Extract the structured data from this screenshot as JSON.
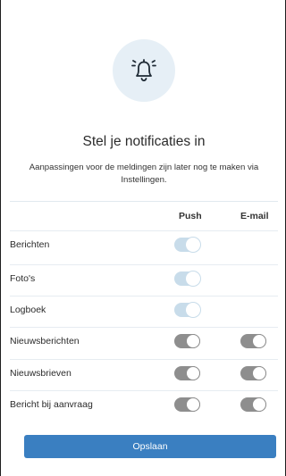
{
  "header": {
    "icon": "bell-icon",
    "title": "Stel je notificaties in",
    "subtitle": "Aanpassingen voor de meldingen zijn later nog te maken via Instellingen."
  },
  "columns": {
    "push": "Push",
    "email": "E-mail"
  },
  "rows": [
    {
      "label": "Berichten",
      "push": "on",
      "email": null
    },
    {
      "label": "Foto's",
      "push": "on",
      "email": null
    },
    {
      "label": "Logboek",
      "push": "on",
      "email": null
    },
    {
      "label": "Nieuwsberichten",
      "push": "off",
      "email": "off"
    },
    {
      "label": "Nieuwsbrieven",
      "push": "off",
      "email": "off"
    },
    {
      "label": "Bericht bij aanvraag",
      "push": "off",
      "email": "off"
    }
  ],
  "save_button": {
    "label": "Opslaan"
  },
  "colors": {
    "accent": "#3a7fc1",
    "toggle_on": "#c8dcea",
    "toggle_off": "#8e8e8e",
    "icon_bg": "#e6eff6"
  }
}
